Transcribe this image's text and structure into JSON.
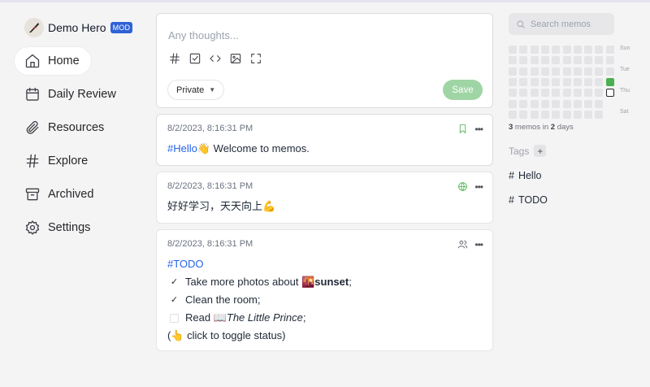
{
  "user": {
    "name": "Demo Hero",
    "badge": "MOD"
  },
  "nav": [
    {
      "label": "Home",
      "icon": "home-icon",
      "active": true
    },
    {
      "label": "Daily Review",
      "icon": "calendar-icon"
    },
    {
      "label": "Resources",
      "icon": "paperclip-icon"
    },
    {
      "label": "Explore",
      "icon": "hash-icon"
    },
    {
      "label": "Archived",
      "icon": "archive-icon"
    },
    {
      "label": "Settings",
      "icon": "gear-icon"
    }
  ],
  "editor": {
    "placeholder": "Any thoughts...",
    "visibility": "Private",
    "save_label": "Save",
    "tools": [
      "hash-icon",
      "checkbox-icon",
      "code-icon",
      "image-icon",
      "fullscreen-icon"
    ]
  },
  "memos": [
    {
      "time": "8/2/2023, 8:16:31 PM",
      "tag": "#Hello",
      "emoji": "👋",
      "text": " Welcome to memos.",
      "status_icon": "bookmark-icon"
    },
    {
      "time": "8/2/2023, 8:16:31 PM",
      "text": "好好学习，天天向上💪",
      "status_icon": "globe-icon"
    },
    {
      "time": "8/2/2023, 8:16:31 PM",
      "tag": "#TODO",
      "status_icon": "users-icon",
      "tasks": [
        {
          "checked": true,
          "pre": "Take more photos about 🌇 ",
          "bold": "sunset",
          "post": ";"
        },
        {
          "checked": true,
          "pre": "Clean the room;"
        },
        {
          "checked": false,
          "pre": "Read 📖 ",
          "italic": "The Little Prince",
          "post": ";"
        }
      ],
      "footer": "(👆 click to toggle status)"
    }
  ],
  "sidebar_right": {
    "search_placeholder": "Search memos",
    "weekdays": [
      "Sun",
      "Tue",
      "Thu",
      "Sat"
    ],
    "stat": {
      "memos": "3",
      "mid": " memos in ",
      "days": "2",
      "end": " days"
    },
    "tags_label": "Tags",
    "tags": [
      "Hello",
      "TODO"
    ]
  },
  "colors": {
    "accent_green": "#4caf50",
    "tag_blue": "#2563eb",
    "badge_blue": "#2f62d8",
    "save_green": "#9fd5a4"
  }
}
